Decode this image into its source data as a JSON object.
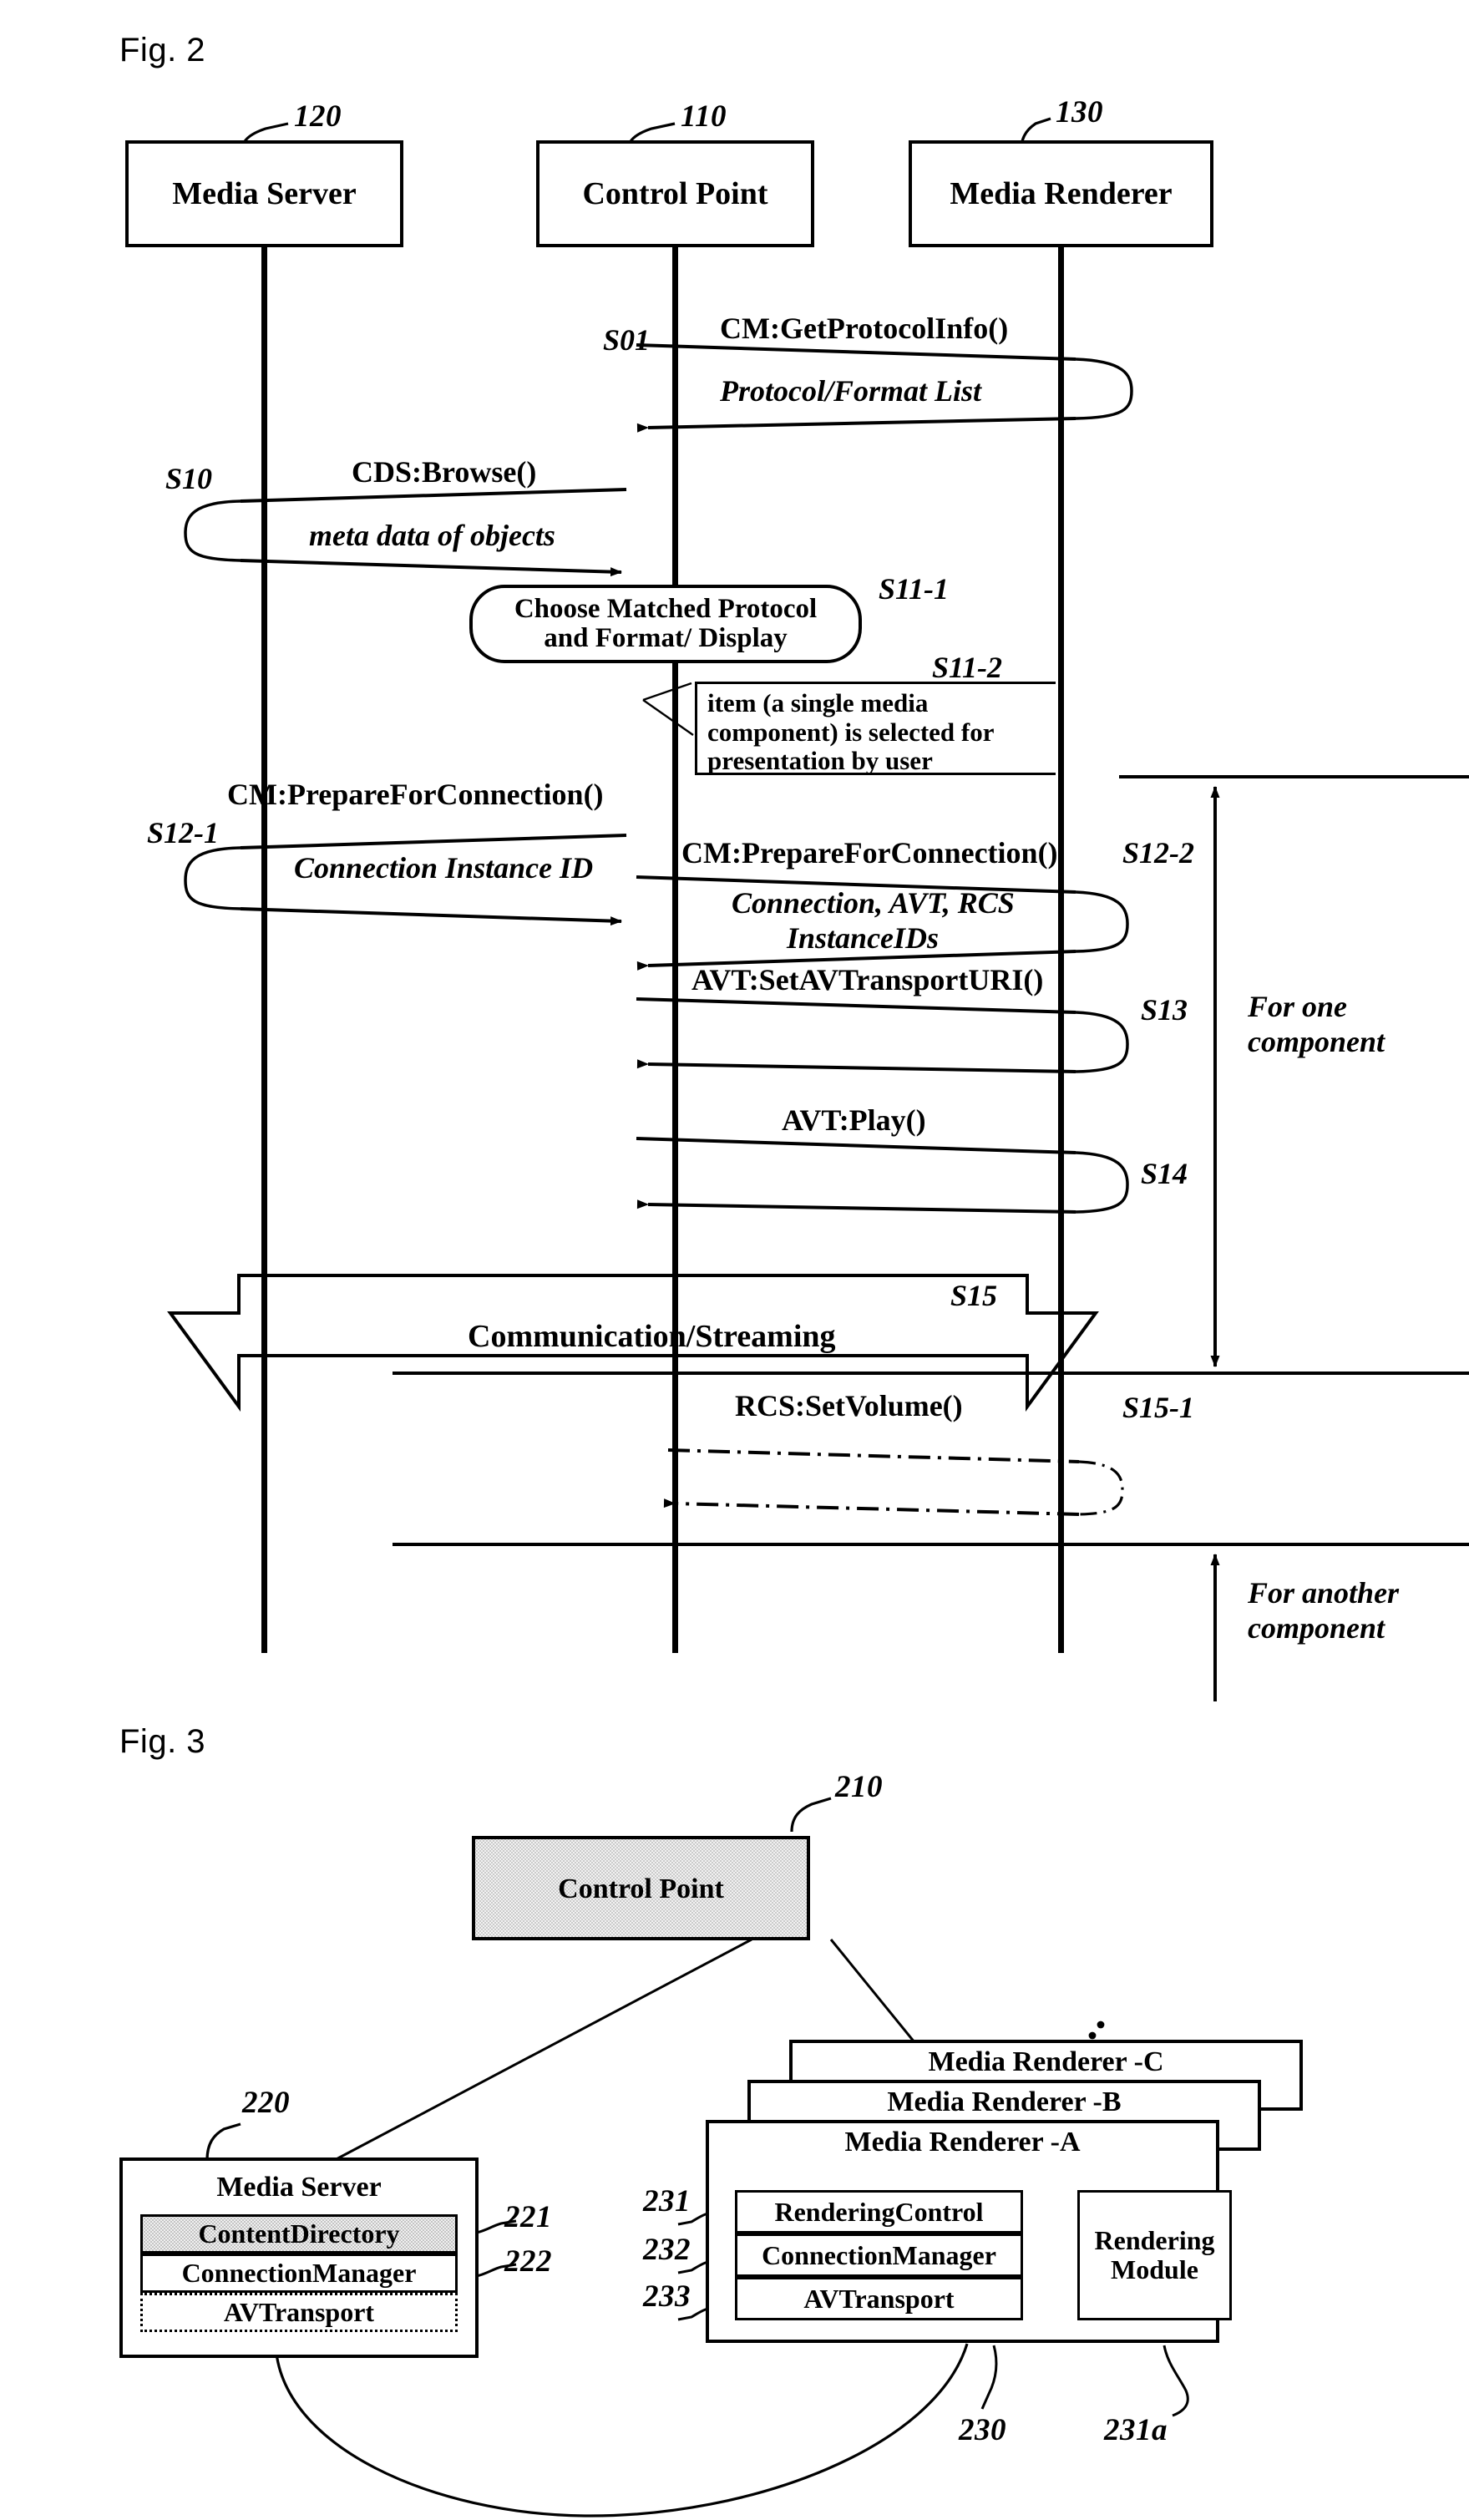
{
  "figures": [
    {
      "id": "fig2",
      "caption": "Fig. 2"
    },
    {
      "id": "fig3",
      "caption": "Fig. 3"
    }
  ],
  "fig2": {
    "caption": "Fig. 2",
    "entities": [
      {
        "label": "Media Server",
        "ref": "120"
      },
      {
        "label": "Control Point",
        "ref": "110"
      },
      {
        "label": "Media Renderer",
        "ref": "130"
      }
    ],
    "messages": [
      {
        "step": "S01",
        "label": "CM:GetProtocolInfo()",
        "reply": "Protocol/Format List",
        "from": "Control Point",
        "to": "Media Renderer",
        "style": "solid"
      },
      {
        "step": "S10",
        "label": "CDS:Browse()",
        "reply": "meta data of objects",
        "from": "Control Point",
        "to": "Media Server",
        "style": "solid"
      },
      {
        "step": "S12-1",
        "label": "CM:PrepareForConnection()",
        "reply": "Connection Instance ID",
        "from": "Control Point",
        "to": "Media Server",
        "style": "solid"
      },
      {
        "step": "S12-2",
        "label": "CM:PrepareForConnection()",
        "reply": "Connection, AVT, RCS InstanceIDs",
        "from": "Control Point",
        "to": "Media Renderer",
        "style": "solid"
      },
      {
        "step": "S13",
        "label": "AVT:SetAVTransportURI()",
        "reply": "",
        "from": "Control Point",
        "to": "Media Renderer",
        "style": "solid"
      },
      {
        "step": "S14",
        "label": "AVT:Play()",
        "reply": "",
        "from": "Control Point",
        "to": "Media Renderer",
        "style": "solid"
      },
      {
        "step": "S15-1",
        "label": "RCS:SetVolume()",
        "reply": "",
        "from": "Control Point",
        "to": "Media Renderer",
        "style": "dash-dot"
      }
    ],
    "reply_line2": "InstanceIDs",
    "bubble": {
      "step": "S11-1",
      "line1": "Choose Matched Protocol",
      "line2": "and Format/ Display"
    },
    "note": {
      "step": "S11-2",
      "line1": "item (a single media",
      "line2": "component) is selected for",
      "line3": "presentation by user"
    },
    "streaming": {
      "step": "S15",
      "label": "Communication/Streaming"
    },
    "brackets": [
      {
        "line1": "For one",
        "line2": "component"
      },
      {
        "line1": "For another",
        "line2": "component"
      }
    ]
  },
  "fig3": {
    "caption": "Fig. 3",
    "control_point": {
      "label": "Control Point",
      "ref": "210"
    },
    "media_server": {
      "label": "Media Server",
      "ref": "220",
      "services": [
        {
          "label": "ContentDirectory",
          "ref": "221",
          "shaded": true,
          "dotted": false
        },
        {
          "label": "ConnectionManager",
          "ref": "222",
          "shaded": false,
          "dotted": false
        },
        {
          "label": "AVTransport",
          "ref": "",
          "shaded": false,
          "dotted": true
        }
      ]
    },
    "media_renderers": {
      "stack": [
        {
          "label": "Media Renderer -C"
        },
        {
          "label": "Media Renderer -B"
        },
        {
          "label": "Media Renderer -A"
        }
      ],
      "ref": "230",
      "services": [
        {
          "label": "RenderingControl",
          "ref": "231"
        },
        {
          "label": "ConnectionManager",
          "ref": "232"
        },
        {
          "label": "AVTransport",
          "ref": "233"
        }
      ],
      "module": {
        "line1": "Rendering",
        "line2": "Module",
        "ref": "231a"
      }
    },
    "ellipsis": "··"
  },
  "colors": {
    "stroke": "#000000",
    "background": "#ffffff",
    "shade_fill": "#f0f0f0"
  }
}
